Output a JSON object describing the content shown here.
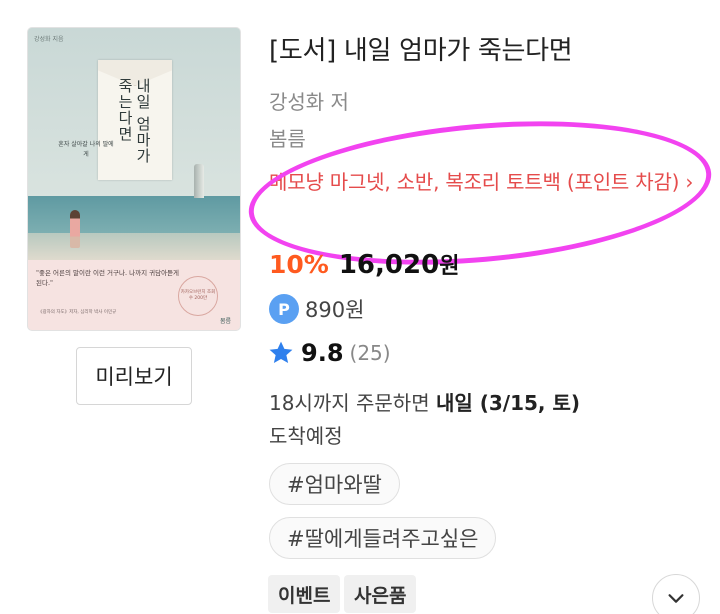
{
  "cover": {
    "author_small": "강성화 지음",
    "title_vertical": "내일 엄마가 죽는다면",
    "subtitle": "혼자 살아갈 나의 딸에게",
    "quote": "\"좋은 어른의 말이란 이런 거구나. 나까지 귀담아듣게 된다.\"",
    "small_line": "《광자의 자도》저자, 심리학 박사 이민규",
    "seal_text": "카카오브런치 조회수 200만",
    "publisher_logo": "봄름"
  },
  "preview": {
    "label": "미리보기"
  },
  "product": {
    "title": "[도서] 내일 엄마가 죽는다면",
    "author": "강성화 저",
    "publisher": "봄름",
    "gift_text": "메모냥 마그넷, 소반, 복조리 토트백 (포인트 차감) ›",
    "discount": "10%",
    "price": "16,020",
    "price_unit": "원",
    "points_badge": "P",
    "points": "890원",
    "rating": "9.8",
    "review_count": "(25)",
    "delivery_prefix": "18시까지 주문하면 ",
    "delivery_bold": "내일 (3/15, 토)",
    "delivery_suffix": "도착예정"
  },
  "tags": [
    "#엄마와딸",
    "#딸에게들려주고싶은"
  ],
  "badges": [
    "이벤트",
    "사은품"
  ],
  "icons": {
    "rating": "star-icon",
    "expand": "chevron-down-icon"
  },
  "colors": {
    "discount": "#ff5a1f",
    "gift_link": "#e54b4b",
    "highlight_annotation": "#f243f0",
    "star": "#2f80ed",
    "points_badge": "#5aa0f2"
  }
}
